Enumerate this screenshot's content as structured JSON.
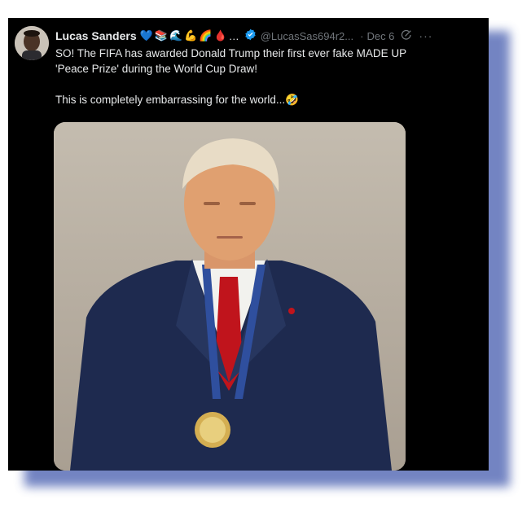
{
  "tweet": {
    "author_name": "Lucas Sanders",
    "name_emojis": [
      "💙",
      "📚",
      "🌊",
      "💪",
      "🌈",
      "🩸",
      "…"
    ],
    "handle": "@LucasSas694r2...",
    "separator": "·",
    "date": "Dec 6",
    "more": "···",
    "lines": [
      "SO! The FIFA has awarded Donald Trump their first ever fake MADE UP",
      "'Peace Prize' during the World Cup Draw!"
    ],
    "line2": "This is completely embarrassing for the world...🤣"
  },
  "colors": {
    "background": "#000000",
    "text": "#e7e9ea",
    "muted": "#71767b",
    "verified": "#1d9bf0",
    "frame_shadow": "#5b6fb8"
  },
  "icons": {
    "verified": "verified-badge-icon",
    "grok": "grok-icon",
    "more": "more-options-icon"
  }
}
